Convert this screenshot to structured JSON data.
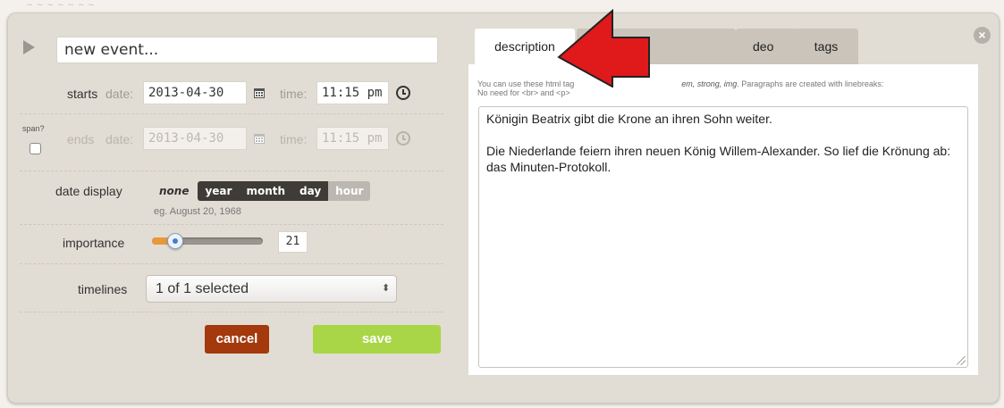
{
  "backdrop": {
    "text": "~ ~ ~ ~ ~ ~ ~"
  },
  "event": {
    "title": "new event..."
  },
  "starts": {
    "label": "starts",
    "date_label": "date:",
    "date": "2013-04-30",
    "time_label": "time:",
    "time": "11:15 pm"
  },
  "ends": {
    "span_label": "span?",
    "label": "ends",
    "date_label": "date:",
    "date": "2013-04-30",
    "time_label": "time:",
    "time": "11:15 pm"
  },
  "date_display": {
    "label": "date display",
    "options": [
      "none",
      "year",
      "month",
      "day",
      "hour"
    ],
    "hint": "eg. August 20, 1968"
  },
  "importance": {
    "label": "importance",
    "value": "21",
    "level": 0.21
  },
  "timelines": {
    "label": "timelines",
    "selected": "1 of 1 selected"
  },
  "buttons": {
    "cancel": "cancel",
    "save": "save"
  },
  "tabs": [
    {
      "label": "description",
      "active": true
    },
    {
      "label": "",
      "active": false
    },
    {
      "label": "deo",
      "active": false
    },
    {
      "label": "tags",
      "active": false
    }
  ],
  "html_hint": {
    "line1_start": "You can use these html tag",
    "tags": "em, strong, img",
    "line1_end": ". Paragraphs are created with linebreaks:",
    "line2": "No need for <br> and <p>"
  },
  "description": {
    "p1": "Königin Beatrix gibt die Krone an ihren Sohn weiter.",
    "p2": "Die Niederlande feiern ihren neuen König Willem-Alexander. So lief die Krönung ab: das Minuten-Protokoll."
  },
  "colors": {
    "cancel": "#a3390c",
    "save": "#a8d646",
    "arrow": "#e0191b",
    "slider_fill": "#e8973b"
  }
}
